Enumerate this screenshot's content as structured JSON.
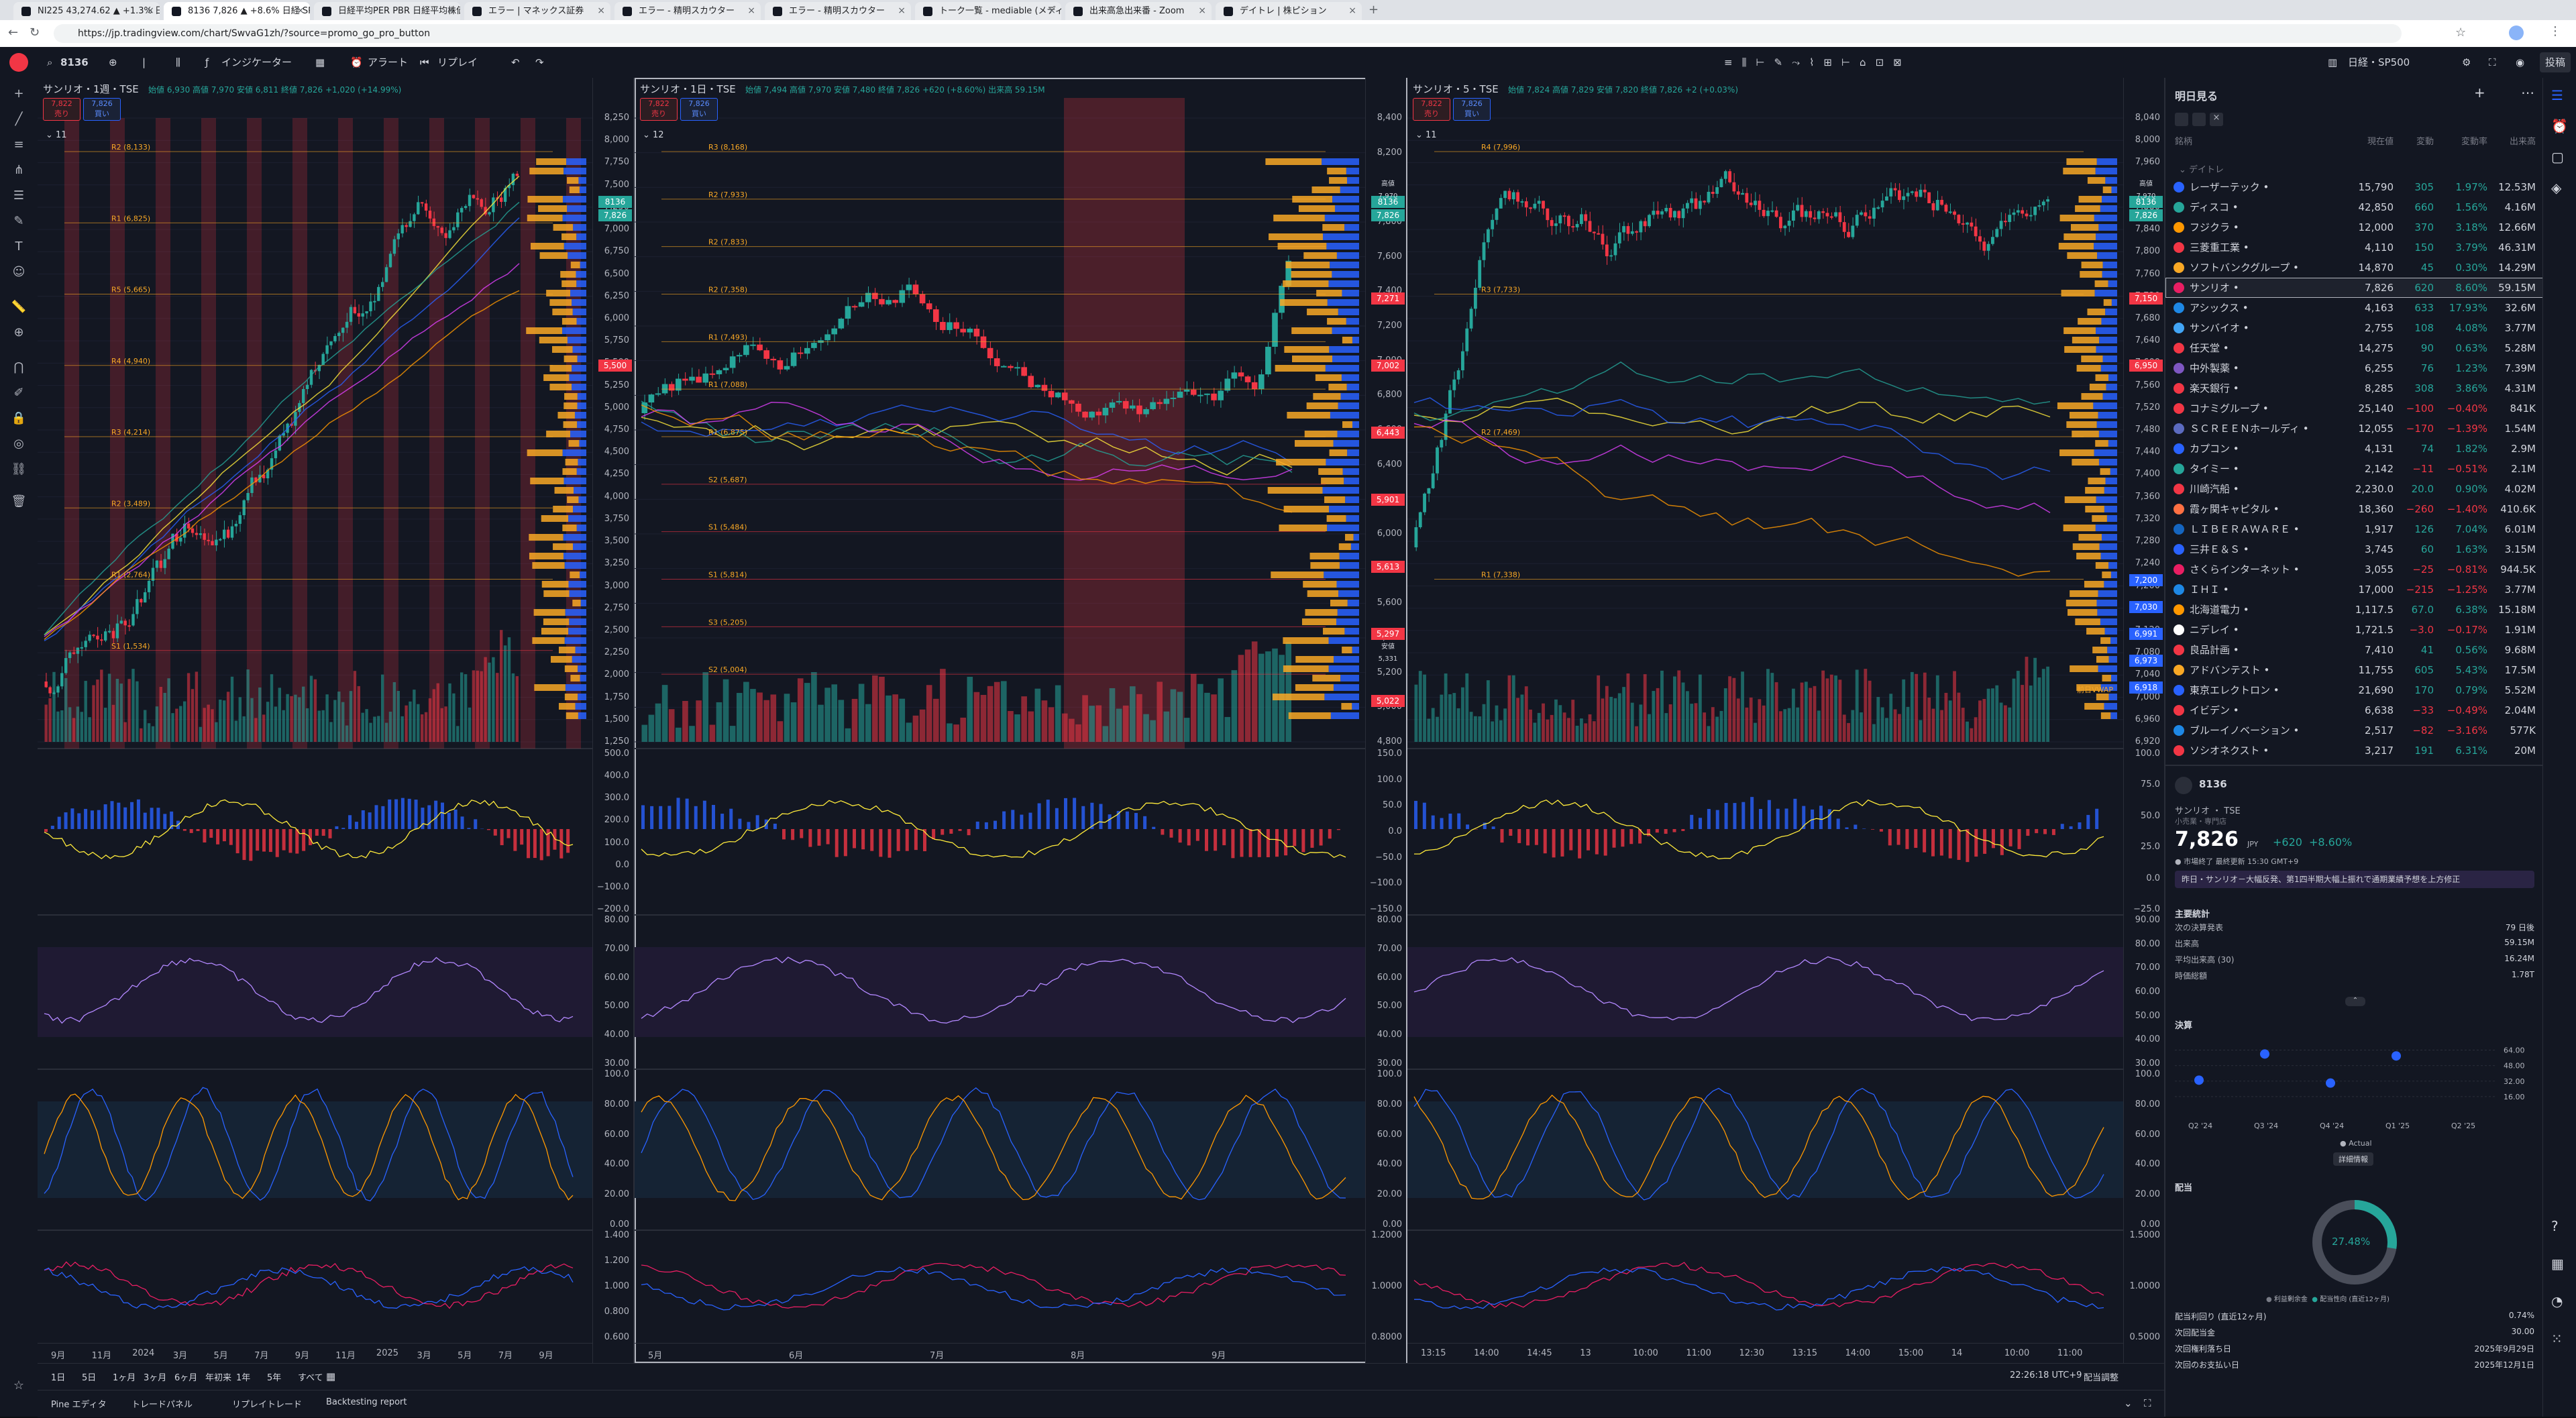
{
  "browser": {
    "tabs": [
      {
        "label": "NI225 43,274.62 ▲ +1.3% 日経...",
        "active": false
      },
      {
        "label": "8136 7,826 ▲ +8.6% 日経 SP500",
        "active": true
      },
      {
        "label": "日経平均PER PBR 日経平均株価...",
        "active": false
      },
      {
        "label": "エラー | マネックス証券",
        "active": false
      },
      {
        "label": "エラー - 精明スカウター",
        "active": false
      },
      {
        "label": "エラー - 精明スカウター",
        "active": false
      },
      {
        "label": "トーク一覧 - mediable (メディアブル)",
        "active": false
      },
      {
        "label": "出来高急出来番 - Zoom",
        "active": false
      },
      {
        "label": "デイトレ | 株ピション",
        "active": false
      }
    ],
    "url": "https://jp.tradingview.com/chart/SwvaG1zh/?source=promo_go_pro_button"
  },
  "toolbar": {
    "symbol": "8136",
    "indicators_label": "インジケーター",
    "alert_label": "アラート",
    "replay_label": "リプレイ",
    "layout_label": "日経・SP500",
    "publish_label": "投稿"
  },
  "panes": [
    {
      "title": "サンリオ・1週・TSE",
      "ohlc": "始値 6,930 高値 7,970 安値 6,811 終値 7,826 +1,020 (+14.99%)",
      "bid": "7,822",
      "bid_label": "売り",
      "ask": "7,826",
      "ask_label": "買い",
      "count": "11",
      "price_ticks": [
        "8,250",
        "8,000",
        "7,750",
        "7,500",
        "7,250",
        "7,000",
        "6,750",
        "6,500",
        "6,250",
        "6,000",
        "5,750",
        "5,500",
        "5,250",
        "5,000",
        "4,750",
        "4,500",
        "4,250",
        "4,000",
        "3,750",
        "3,500",
        "3,250",
        "3,000",
        "2,750",
        "2,500",
        "2,250",
        "2,000",
        "1,750",
        "1,500",
        "1,250"
      ],
      "osc_ticks": [
        "500.0",
        "400.0",
        "300.0",
        "200.0",
        "100.0",
        "0.0",
        "−100.0",
        "−200.0"
      ],
      "rsi_ticks": [
        "80.00",
        "70.00",
        "60.00",
        "50.00",
        "40.00",
        "30.00"
      ],
      "stoch_ticks": [
        "100.0",
        "80.00",
        "60.00",
        "40.00",
        "20.00",
        "0.00"
      ],
      "cmp_ticks": [
        "1.400",
        "1.200",
        "1.000",
        "0.800",
        "0.600"
      ],
      "time_labels": [
        "9月",
        "11月",
        "2024",
        "3月",
        "5月",
        "7月",
        "9月",
        "11月",
        "2025",
        "3月",
        "5月",
        "7月",
        "9月"
      ],
      "pivots": [
        "R2 (8,133)",
        "R1 (6,825)",
        "R5 (5,665)",
        "R4 (4,940)",
        "R3 (4,214)",
        "R2 (3,489)",
        "R1 (2,764)",
        "S1 (1,534)"
      ],
      "tag_symbol": "8136",
      "tag_price": "7,826",
      "tag_red": "5,500"
    },
    {
      "title": "サンリオ・1日・TSE",
      "ohlc": "始値 7,494 高値 7,970 安値 7,480 終値 7,826 +620 (+8.60%) 出来高 59.15M",
      "bid": "7,822",
      "bid_label": "売り",
      "ask": "7,826",
      "ask_label": "買い",
      "count": "12",
      "price_ticks": [
        "8,400",
        "8,200",
        "8,000",
        "7,800",
        "7,600",
        "7,400",
        "7,200",
        "7,000",
        "6,800",
        "6,600",
        "6,400",
        "6,200",
        "6,000",
        "5,800",
        "5,600",
        "5,400",
        "5,200",
        "5,000",
        "4,800"
      ],
      "osc_ticks": [
        "150.0",
        "100.0",
        "50.0",
        "0.0",
        "−50.0",
        "−100.0",
        "−150.0"
      ],
      "rsi_ticks": [
        "80.00",
        "70.00",
        "60.00",
        "50.00",
        "40.00",
        "30.00"
      ],
      "stoch_ticks": [
        "100.0",
        "80.00",
        "60.00",
        "40.00",
        "20.00",
        "0.00"
      ],
      "cmp_ticks": [
        "1.2000",
        "1.0000",
        "0.8000"
      ],
      "time_labels": [
        "5月",
        "6月",
        "7月",
        "8月",
        "9月"
      ],
      "pivots": [
        "R3 (8,168)",
        "R2 (7,933)",
        "R2 (7,833)",
        "R2 (7,358)",
        "R1 (7,493)",
        "R1 (7,088)",
        "R1 (6,875)",
        "S2 (5,687)",
        "S1 (5,484)",
        "S1 (5,814)",
        "S3 (5,205)",
        "S2 (5,004)"
      ],
      "hi_label": "高値",
      "hi_val": "7,970",
      "lo_label": "安値",
      "lo_val": "5,331",
      "tag_symbol": "8136",
      "tag_price": "7,826",
      "red_tags": [
        "7,271",
        "7,002",
        "6,443",
        "5,901",
        "5,613",
        "5,297",
        "5,022"
      ]
    },
    {
      "title": "サンリオ・5・TSE",
      "ohlc": "始値 7,824 高値 7,829 安値 7,820 終値 7,826 +2 (+0.03%)",
      "bid": "7,822",
      "bid_label": "売り",
      "ask": "7,826",
      "ask_label": "買い",
      "count": "11",
      "price_ticks": [
        "8,040",
        "8,000",
        "7,960",
        "7,920",
        "7,880",
        "7,840",
        "7,800",
        "7,760",
        "7,720",
        "7,680",
        "7,640",
        "7,600",
        "7,560",
        "7,520",
        "7,480",
        "7,440",
        "7,400",
        "7,360",
        "7,320",
        "7,280",
        "7,240",
        "7,200",
        "7,160",
        "7,120",
        "7,080",
        "7,040",
        "7,000",
        "6,960",
        "6,920"
      ],
      "osc_ticks": [
        "100.0",
        "75.0",
        "50.0",
        "25.0",
        "0.0",
        "−25.0"
      ],
      "rsi_ticks": [
        "90.00",
        "80.00",
        "70.00",
        "60.00",
        "50.00",
        "40.00",
        "30.00"
      ],
      "stoch_ticks": [
        "100.0",
        "80.00",
        "60.00",
        "40.00",
        "20.00",
        "0.00"
      ],
      "cmp_ticks": [
        "1.5000",
        "1.0000",
        "0.5000"
      ],
      "time_labels": [
        "13:15",
        "14:00",
        "14:45",
        "13",
        "10:00",
        "11:00",
        "12:30",
        "13:15",
        "14:00",
        "15:00",
        "14",
        "10:00",
        "11:00"
      ],
      "pivots": [
        "R4 (7,996)",
        "R3 (7,733)",
        "R2 (7,469)",
        "R1 (7,338)"
      ],
      "hi_label": "高値",
      "hi_val": "7,970",
      "tag_symbol": "8136",
      "tag_price": "7,826",
      "open_label": "前日VWAP",
      "blue_tags": [
        "7,200",
        "7,030",
        "6,991",
        "6,973",
        "6,918"
      ],
      "red_tags": [
        "7,150",
        "6,950"
      ]
    }
  ],
  "bottom": {
    "ranges": [
      "1日",
      "5日",
      "1ヶ月",
      "3ヶ月",
      "6ヶ月",
      "年初来",
      "1年",
      "5年",
      "すべて"
    ],
    "clock": "22:26:18 UTC+9",
    "adjust_label": "配当調整",
    "panels": [
      "Pine エディタ",
      "トレードパネル",
      "リプレイトレード",
      "Backtesting report"
    ]
  },
  "watchlist": {
    "title": "明日見る",
    "headers": {
      "symbol": "銘柄",
      "last": "現在値",
      "chg": "変動",
      "chgp": "変動率",
      "vol": "出来高"
    },
    "section": "デイトレ",
    "rows": [
      {
        "name": "レーザーテック",
        "last": "15,790",
        "chg": "305",
        "chgp": "1.97%",
        "vol": "12.53M",
        "dir": "up",
        "color": "#2962ff"
      },
      {
        "name": "ディスコ",
        "last": "42,850",
        "chg": "660",
        "chgp": "1.56%",
        "vol": "4.16M",
        "dir": "up",
        "color": "#26a69a"
      },
      {
        "name": "フジクラ",
        "last": "12,000",
        "chg": "370",
        "chgp": "3.18%",
        "vol": "12.66M",
        "dir": "up",
        "color": "#ff9800"
      },
      {
        "name": "三菱重工業",
        "last": "4,110",
        "chg": "150",
        "chgp": "3.79%",
        "vol": "46.31M",
        "dir": "up",
        "color": "#f23645"
      },
      {
        "name": "ソフトバンクグループ",
        "last": "14,870",
        "chg": "45",
        "chgp": "0.30%",
        "vol": "14.29M",
        "dir": "up",
        "color": "#f9a825"
      },
      {
        "name": "サンリオ",
        "last": "7,826",
        "chg": "620",
        "chgp": "8.60%",
        "vol": "59.15M",
        "dir": "up",
        "color": "#e91e63",
        "hl": true
      },
      {
        "name": "アシックス",
        "last": "4,163",
        "chg": "633",
        "chgp": "17.93%",
        "vol": "32.6M",
        "dir": "up",
        "color": "#1e88e5"
      },
      {
        "name": "サンバイオ",
        "last": "2,755",
        "chg": "108",
        "chgp": "4.08%",
        "vol": "3.77M",
        "dir": "up",
        "color": "#42a5f5"
      },
      {
        "name": "任天堂",
        "last": "14,275",
        "chg": "90",
        "chgp": "0.63%",
        "vol": "5.28M",
        "dir": "up",
        "color": "#f23645"
      },
      {
        "name": "中外製薬",
        "last": "6,255",
        "chg": "76",
        "chgp": "1.23%",
        "vol": "7.39M",
        "dir": "up",
        "color": "#7e57c2"
      },
      {
        "name": "楽天銀行",
        "last": "8,285",
        "chg": "308",
        "chgp": "3.86%",
        "vol": "4.31M",
        "dir": "up",
        "color": "#f23645"
      },
      {
        "name": "コナミグループ",
        "last": "25,140",
        "chg": "−100",
        "chgp": "−0.40%",
        "vol": "841K",
        "dir": "dn",
        "color": "#f23645"
      },
      {
        "name": "ＳＣＲＥＥＮホールディ",
        "last": "12,055",
        "chg": "−170",
        "chgp": "−1.39%",
        "vol": "1.54M",
        "dir": "dn",
        "color": "#5c6bc0"
      },
      {
        "name": "カプコン",
        "last": "4,131",
        "chg": "74",
        "chgp": "1.82%",
        "vol": "2.9M",
        "dir": "up",
        "color": "#2962ff"
      },
      {
        "name": "タイミー",
        "last": "2,142",
        "chg": "−11",
        "chgp": "−0.51%",
        "vol": "2.1M",
        "dir": "dn",
        "color": "#26a69a"
      },
      {
        "name": "川崎汽船",
        "last": "2,230.0",
        "chg": "20.0",
        "chgp": "0.90%",
        "vol": "4.02M",
        "dir": "up",
        "color": "#f23645"
      },
      {
        "name": "霞ヶ関キャピタル",
        "last": "18,360",
        "chg": "−260",
        "chgp": "−1.40%",
        "vol": "410.6K",
        "dir": "dn",
        "color": "#ff7043"
      },
      {
        "name": "ＬＩＢＥＲＡＷＡＲＥ",
        "last": "1,917",
        "chg": "126",
        "chgp": "7.04%",
        "vol": "6.01M",
        "dir": "up",
        "color": "#1565c0"
      },
      {
        "name": "三井Ｅ＆Ｓ",
        "last": "3,745",
        "chg": "60",
        "chgp": "1.63%",
        "vol": "3.15M",
        "dir": "up",
        "color": "#2962ff"
      },
      {
        "name": "さくらインターネット",
        "last": "3,055",
        "chg": "−25",
        "chgp": "−0.81%",
        "vol": "944.5K",
        "dir": "dn",
        "color": "#e91e63"
      },
      {
        "name": "ＩＨＩ",
        "last": "17,000",
        "chg": "−215",
        "chgp": "−1.25%",
        "vol": "3.77M",
        "dir": "dn",
        "color": "#1e88e5"
      },
      {
        "name": "北海道電力",
        "last": "1,117.5",
        "chg": "67.0",
        "chgp": "6.38%",
        "vol": "15.18M",
        "dir": "up",
        "color": "#ff9800"
      },
      {
        "name": "ニデレイ",
        "last": "1,721.5",
        "chg": "−3.0",
        "chgp": "−0.17%",
        "vol": "1.91M",
        "dir": "dn",
        "color": "#ffffff"
      },
      {
        "name": "良品計画",
        "last": "7,410",
        "chg": "41",
        "chgp": "0.56%",
        "vol": "9.68M",
        "dir": "up",
        "color": "#f23645"
      },
      {
        "name": "アドバンテスト",
        "last": "11,755",
        "chg": "605",
        "chgp": "5.43%",
        "vol": "17.5M",
        "dir": "up",
        "color": "#f9a825"
      },
      {
        "name": "東京エレクトロン",
        "last": "21,690",
        "chg": "170",
        "chgp": "0.79%",
        "vol": "5.52M",
        "dir": "up",
        "color": "#2962ff"
      },
      {
        "name": "イビデン",
        "last": "6,638",
        "chg": "−33",
        "chgp": "−0.49%",
        "vol": "2.04M",
        "dir": "dn",
        "color": "#f23645"
      },
      {
        "name": "ブルーイノベーション",
        "last": "2,517",
        "chg": "−82",
        "chgp": "−3.16%",
        "vol": "577K",
        "dir": "dn",
        "color": "#1e88e5"
      },
      {
        "name": "ソシオネクスト",
        "last": "3,217",
        "chg": "191",
        "chgp": "6.31%",
        "vol": "20M",
        "dir": "up",
        "color": "#f23645"
      }
    ]
  },
  "details": {
    "symbol": "8136",
    "name": "サンリオ",
    "exchange": "TSE",
    "sector": "小売業・専門店",
    "price": "7,826",
    "currency": "JPY",
    "change": "+620",
    "change_pct": "+8.60%",
    "status": "市場終了",
    "last_update": "最終更新 15:30 GMT+9",
    "news": "昨日・サンリオ－大幅反発、第1四半期大幅上振れで通期業績予想を上方修正",
    "key_stats_title": "主要統計",
    "stats": [
      {
        "label": "次の決算発表",
        "value": "79 日後"
      },
      {
        "label": "出来高",
        "value": "59.15M"
      },
      {
        "label": "平均出来高 (30)",
        "value": "16.24M"
      },
      {
        "label": "時価総額",
        "value": "1.78T"
      }
    ],
    "earnings_title": "決算",
    "earnings_quarters": [
      "Q2 '24",
      "Q3 '24",
      "Q4 '24",
      "Q1 '25",
      "Q2 '25"
    ],
    "earnings_axis": [
      "64.00",
      "48.00",
      "32.00",
      "16.00"
    ],
    "earnings_points": [
      {
        "q": 0,
        "v": 33
      },
      {
        "q": 1,
        "v": 60
      },
      {
        "q": 2,
        "v": 30
      },
      {
        "q": 3,
        "v": 58
      }
    ],
    "earnings_legend": "Actual",
    "more_label": "詳細情報",
    "dividend_title": "配当",
    "dividend_pct": "27.48%",
    "dividend_legend": [
      "利益剰余金",
      "配当性向 (直近12ヶ月)"
    ],
    "dividend_rows": [
      {
        "label": "配当利回り (直近12ヶ月)",
        "value": "0.74%"
      },
      {
        "label": "次回配当金",
        "value": "30.00"
      },
      {
        "label": "次回権利落ち日",
        "value": "2025年9月29日"
      },
      {
        "label": "次回のお支払い日",
        "value": "2025年12月1日"
      }
    ]
  }
}
